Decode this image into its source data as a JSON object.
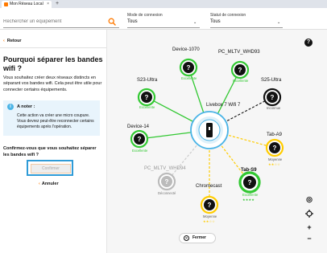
{
  "browser": {
    "tab_title": "Mon Réseau Local",
    "close_glyph": "×",
    "new_tab_glyph": "+"
  },
  "filters": {
    "search_placeholder": "Rechercher un équipement",
    "mode": {
      "label": "Mode de connexion",
      "value": "Tous"
    },
    "status": {
      "label": "Statut de connexion",
      "value": "Tous"
    }
  },
  "left": {
    "back_label": "Retour",
    "title": "Pourquoi séparer les bandes wifi ?",
    "description": "Vous souhaitez créer deux réseaux distincts en séparant vos bandes wifi. Cela peut être utile pour connecter certains équipements.",
    "note_title": "A noter :",
    "note_body": "Cette action va créer une micro coupure. Vous devrez peut-être reconnecter certains équipements après l'opération.",
    "question": "Confirmez-vous que vous souhaitez séparer les bandes wifi ?",
    "confirm_label": "Confirmer",
    "cancel_label": "Annuler"
  },
  "map": {
    "hub": {
      "label": "Livebox 7 Wifi 7"
    },
    "devices": [
      {
        "name": "Device-1070",
        "status": "Excellente",
        "quality": "excellent",
        "stars": ""
      },
      {
        "name": "PC_MLTV_WHD93",
        "status": "Excellente",
        "quality": "excellent",
        "stars": ""
      },
      {
        "name": "S23-Ultra",
        "status": "Excellente",
        "quality": "excellent",
        "stars": ""
      },
      {
        "name": "S25-Ultra",
        "status": "Inconnue",
        "quality": "unknown",
        "stars": ""
      },
      {
        "name": "Device-14",
        "status": "Excellente",
        "quality": "excellent",
        "stars": ""
      },
      {
        "name": "Tab-A9",
        "status": "Moyenne",
        "quality": "medium",
        "stars": "★★☆☆"
      },
      {
        "name": "PC_MLTV_WHD94",
        "status": "Déconnecté",
        "quality": "disconnected",
        "stars": ""
      },
      {
        "name": "Chromecast",
        "status": "Moyenne",
        "quality": "medium",
        "stars": "★★☆☆"
      },
      {
        "name": "Tab-S9",
        "status": "Excellente",
        "quality": "excellent",
        "stars": "★★★★"
      }
    ],
    "device_glyph": "?",
    "help_glyph": "?",
    "close_label": "Fermer",
    "close_glyph": "✕",
    "controls": {
      "recenter": "◎",
      "zoom_in": "+",
      "zoom_out": "−"
    }
  },
  "colors": {
    "accent": "#ff7900",
    "excellent": "#32c832",
    "medium": "#ffcc00",
    "disconnected": "#bbbbbb",
    "info": "#4bb4e6",
    "hub": "#4bb4e6"
  }
}
